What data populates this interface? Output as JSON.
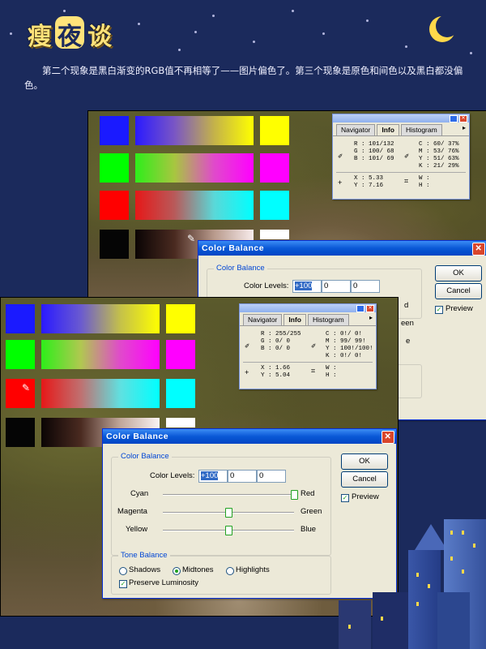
{
  "header": {
    "logo_chars": [
      "瘦",
      "夜",
      "谈"
    ],
    "intro_text": "第二个现象是黑白渐变的RGB值不再相等了——图片偏色了。第三个现象是原色和间色以及黑白都没偏色。"
  },
  "info_panel_1": {
    "tabs": [
      "Navigator",
      "Info",
      "Histogram"
    ],
    "rgb": [
      "R :  101/132",
      "G :  100/ 68",
      "B :  101/ 69"
    ],
    "cmyk": [
      "C :  60/ 37%",
      "M :  53/ 76%",
      "Y :  51/ 63%",
      "K :  21/ 29%"
    ],
    "xy": [
      "X :    5.33",
      "Y :    7.16"
    ],
    "wh": [
      "W :",
      "H :"
    ]
  },
  "info_panel_2": {
    "tabs": [
      "Navigator",
      "Info",
      "Histogram"
    ],
    "rgb": [
      "R :  255/255",
      "G :    0/  0",
      "B :    0/  0"
    ],
    "cmyk": [
      "C :    0!/  0!",
      "M :   99/ 99!",
      "Y :  100!/100!",
      "K :    0!/  0!"
    ],
    "xy": [
      "X :    1.66",
      "Y :    5.04"
    ],
    "wh": [
      "W :",
      "H :"
    ]
  },
  "color_balance_1": {
    "title": "Color Balance",
    "group_label": "Color Balance",
    "levels_label": "Color Levels:",
    "levels": [
      "+100",
      "0",
      "0"
    ],
    "ok": "OK",
    "cancel": "Cancel",
    "preview": "Preview",
    "partial_right": [
      "d",
      "een",
      "e"
    ]
  },
  "color_balance_2": {
    "title": "Color Balance",
    "group_label": "Color Balance",
    "levels_label": "Color Levels:",
    "levels": [
      "+100",
      "0",
      "0"
    ],
    "sliders": [
      {
        "left": "Cyan",
        "right": "Red",
        "value": 100
      },
      {
        "left": "Magenta",
        "right": "Green",
        "value": 0
      },
      {
        "left": "Yellow",
        "right": "Blue",
        "value": 0
      }
    ],
    "tone_label": "Tone Balance",
    "tones": [
      "Shadows",
      "Midtones",
      "Highlights"
    ],
    "selected_tone": "Midtones",
    "preserve": "Preserve Luminosity",
    "ok": "OK",
    "cancel": "Cancel",
    "preview": "Preview"
  },
  "colors": {
    "background": "#1b2a5c",
    "dialog_face": "#ece9d8",
    "titlebar": "#0a58d6"
  }
}
